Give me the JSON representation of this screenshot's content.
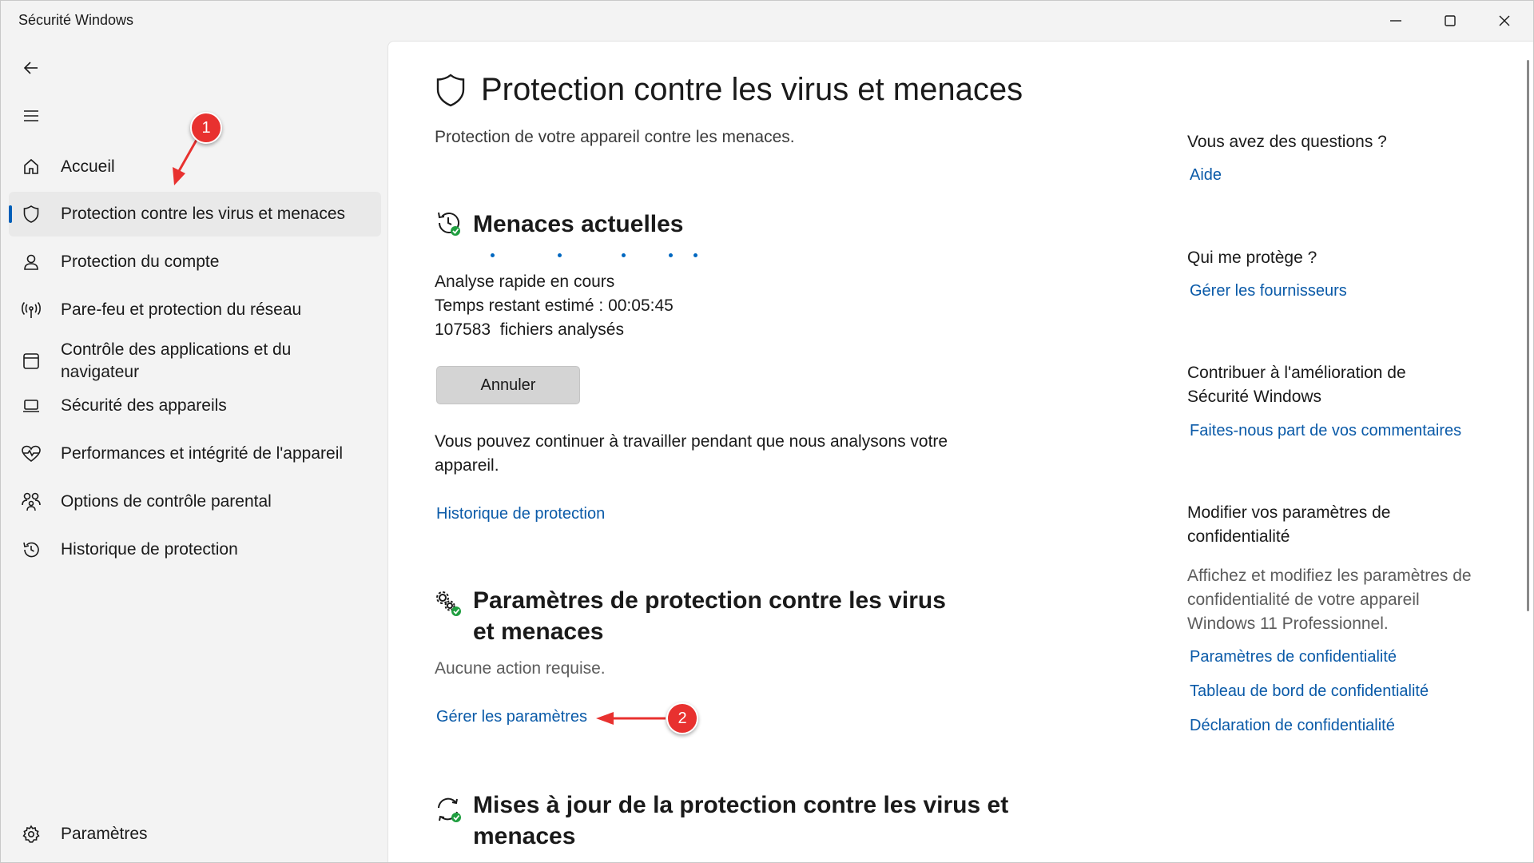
{
  "window": {
    "title": "Sécurité Windows",
    "minimize_icon": "minimize-icon",
    "maximize_icon": "maximize-icon",
    "close_icon": "close-icon"
  },
  "sidebar": {
    "back_icon": "back-arrow-icon",
    "menu_icon": "hamburger-menu-icon",
    "items": [
      {
        "label": "Accueil",
        "icon": "home-icon"
      },
      {
        "label": "Protection contre les virus et menaces",
        "icon": "shield-icon",
        "active": true
      },
      {
        "label": "Protection du compte",
        "icon": "person-icon"
      },
      {
        "label": "Pare-feu et protection du réseau",
        "icon": "network-antenna-icon"
      },
      {
        "label": "Contrôle des applications et du navigateur",
        "icon": "browser-window-icon"
      },
      {
        "label": "Sécurité des appareils",
        "icon": "laptop-icon"
      },
      {
        "label": "Performances et intégrité de l'appareil",
        "icon": "heart-pulse-icon"
      },
      {
        "label": "Options de contrôle parental",
        "icon": "family-icon"
      },
      {
        "label": "Historique de protection",
        "icon": "history-icon"
      }
    ],
    "settings": {
      "label": "Paramètres",
      "icon": "gear-icon"
    }
  },
  "main": {
    "title": "Protection contre les virus et menaces",
    "subtitle": "Protection de votre appareil contre les menaces.",
    "current_threats": {
      "heading": "Menaces actuelles",
      "icon": "scan-clock-icon",
      "status": "Analyse rapide en cours",
      "time_remaining": "Temps restant estimé : 00:05:45",
      "files_scanned": "107583  fichiers analysés",
      "cancel_label": "Annuler",
      "info": "Vous pouvez continuer à travailler pendant que nous analysons votre appareil.",
      "history_link": "Historique de protection"
    },
    "protection_settings": {
      "heading": "Paramètres de protection contre les virus et menaces",
      "icon": "gears-check-icon",
      "status": "Aucune action requise.",
      "manage_link": "Gérer les paramètres"
    },
    "updates": {
      "heading": "Mises à jour de la protection contre les virus et menaces",
      "icon": "refresh-check-icon"
    }
  },
  "aside": {
    "questions": {
      "heading": "Vous avez des questions ?",
      "link": "Aide"
    },
    "who_protects": {
      "heading": "Qui me protège ?",
      "link": "Gérer les fournisseurs"
    },
    "contribute": {
      "heading": "Contribuer à l'amélioration de Sécurité Windows",
      "link": "Faites-nous part de vos commentaires"
    },
    "privacy": {
      "heading": "Modifier vos paramètres de confidentialité",
      "text": "Affichez et modifiez les paramètres de confidentialité de votre appareil Windows 11 Professionnel.",
      "links": [
        "Paramètres de confidentialité",
        "Tableau de bord de confidentialité",
        "Déclaration de confidentialité"
      ]
    }
  },
  "annotations": {
    "badge_1": "1",
    "badge_2": "2",
    "color": "#e8312f"
  },
  "colors": {
    "accent": "#005fb8",
    "link": "#0a5aa8",
    "sidebar_bg": "#f3f3f3",
    "active_item_bg": "#e9e9e9"
  }
}
